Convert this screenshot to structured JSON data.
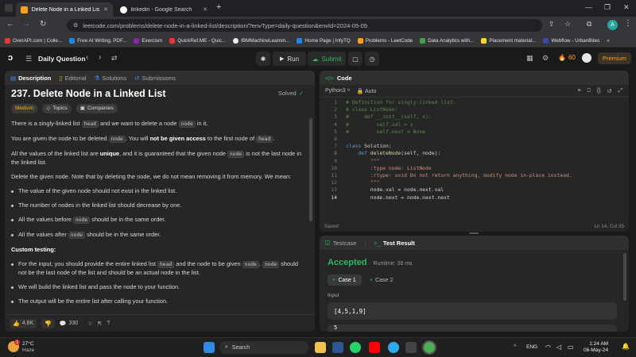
{
  "browser": {
    "tabs": [
      {
        "title": "Delete Node in a Linked List - L",
        "active": true
      },
      {
        "title": "linkedin - Google Search",
        "active": false
      }
    ],
    "new_tab": "+",
    "url": "leetcode.com/problems/delete-node-in-a-linked-list/description/?envType=daily-question&envId=2024-05-05",
    "profile_initial": "A",
    "bookmarks": [
      "OverAPI.com | Colle...",
      "Free AI Writing, PDF...",
      "Exercism",
      "QuickRef.ME - Quic...",
      "IBMMachineLearnin...",
      "Home Page | InfyTQ",
      "Problems - LeetCode",
      "Data Analytics with...",
      "Placement material...",
      "Webflow - UrbanBites"
    ],
    "bookmark_overflow": "»"
  },
  "nav": {
    "daily": "Daily Question",
    "run": "Run",
    "submit": "Submit",
    "streak": "60",
    "premium": "Premium"
  },
  "description": {
    "tabs": [
      "Description",
      "Editorial",
      "Solutions",
      "Submissions"
    ],
    "title": "237. Delete Node in a Linked List",
    "status": "Solved",
    "chips": [
      "Medium",
      "Topics",
      "Companies"
    ],
    "p1a": "There is a singly-linked list ",
    "p1b": "head",
    "p1c": " and we want to delete a node ",
    "p1d": "node",
    "p1e": " in it.",
    "p2a": "You are given the node to be deleted ",
    "p2b": "node",
    "p2c": ". You will ",
    "p2d": "not be given access",
    "p2e": " to the first node of ",
    "p2f": "head",
    "p2g": ".",
    "p3a": "All the values of the linked list are ",
    "p3b": "unique",
    "p3c": ", and it is guaranteed that the given node ",
    "p3d": "node",
    "p3e": " is not the last node in the linked list.",
    "p4": "Delete the given node. Note that by deleting the node, we do not mean removing it from memory. We mean:",
    "b1": "The value of the given node should not exist in the linked list.",
    "b2": "The number of nodes in the linked list should decrease by one.",
    "b3a": "All the values before ",
    "b3b": "node",
    "b3c": " should be in the same order.",
    "b4a": "All the values after ",
    "b4b": "node",
    "b4c": " should be in the same order.",
    "custom": "Custom testing:",
    "c1a": "For the input, you should provide the entire linked list ",
    "c1b": "head",
    "c1c": " and the node to be given ",
    "c1d": "node",
    "c1e": ". ",
    "c1f": "node",
    "c1g": " should not be the last node of the list and should be an actual node in the list.",
    "c2": "We will build the linked list and pass the node to your function.",
    "c3": "The output will be the entire list after calling your function.",
    "likes": "4.8K",
    "comments": "330"
  },
  "code": {
    "title": "Code",
    "lang": "Python3",
    "mode": "Auto",
    "lines": [
      [
        {
          "c": "cm",
          "t": "# Definition for singly-linked list."
        }
      ],
      [
        {
          "c": "cm",
          "t": "# class ListNode:"
        }
      ],
      [
        {
          "c": "cm",
          "t": "#     def __init__(self, x):"
        }
      ],
      [
        {
          "c": "cm",
          "t": "#         self.val = x"
        }
      ],
      [
        {
          "c": "cm",
          "t": "#         self.next = None"
        }
      ],
      [
        {
          "c": "df",
          "t": ""
        }
      ],
      [
        {
          "c": "kw",
          "t": "class "
        },
        {
          "c": "df",
          "t": "Solution:"
        }
      ],
      [
        {
          "c": "df",
          "t": "    "
        },
        {
          "c": "kw",
          "t": "def "
        },
        {
          "c": "fn",
          "t": "deleteNode"
        },
        {
          "c": "df",
          "t": "(self, node):"
        }
      ],
      [
        {
          "c": "st",
          "t": "        \"\"\""
        }
      ],
      [
        {
          "c": "st",
          "t": "        :type node: ListNode"
        }
      ],
      [
        {
          "c": "st",
          "t": "        :rtype: void Do not return anything, modify node in-place instead."
        }
      ],
      [
        {
          "c": "st",
          "t": "        \"\"\""
        }
      ],
      [
        {
          "c": "df",
          "t": "        node.val = node.next.val"
        }
      ],
      [
        {
          "c": "df",
          "t": "        node.next = node.next.next"
        }
      ]
    ],
    "saved": "Saved",
    "cursor": "Ln 14, Col 35"
  },
  "result": {
    "tabs": [
      "Testcase",
      "Test Result"
    ],
    "status": "Accepted",
    "runtime": "Runtime: 39 ms",
    "cases": [
      "Case 1",
      "Case 2"
    ],
    "input_label": "Input",
    "input_value": "[4,5,1,9]",
    "next_value": "5"
  },
  "taskbar": {
    "temp": "27°C",
    "weather": "Haze",
    "search": "Search",
    "lang": "ENG",
    "time": "1:24 AM",
    "date": "06-May-24",
    "badge": "1"
  },
  "colors": {
    "accent": "#ffa116",
    "accepted": "#2cbb5d",
    "medium": "#ffb800"
  }
}
